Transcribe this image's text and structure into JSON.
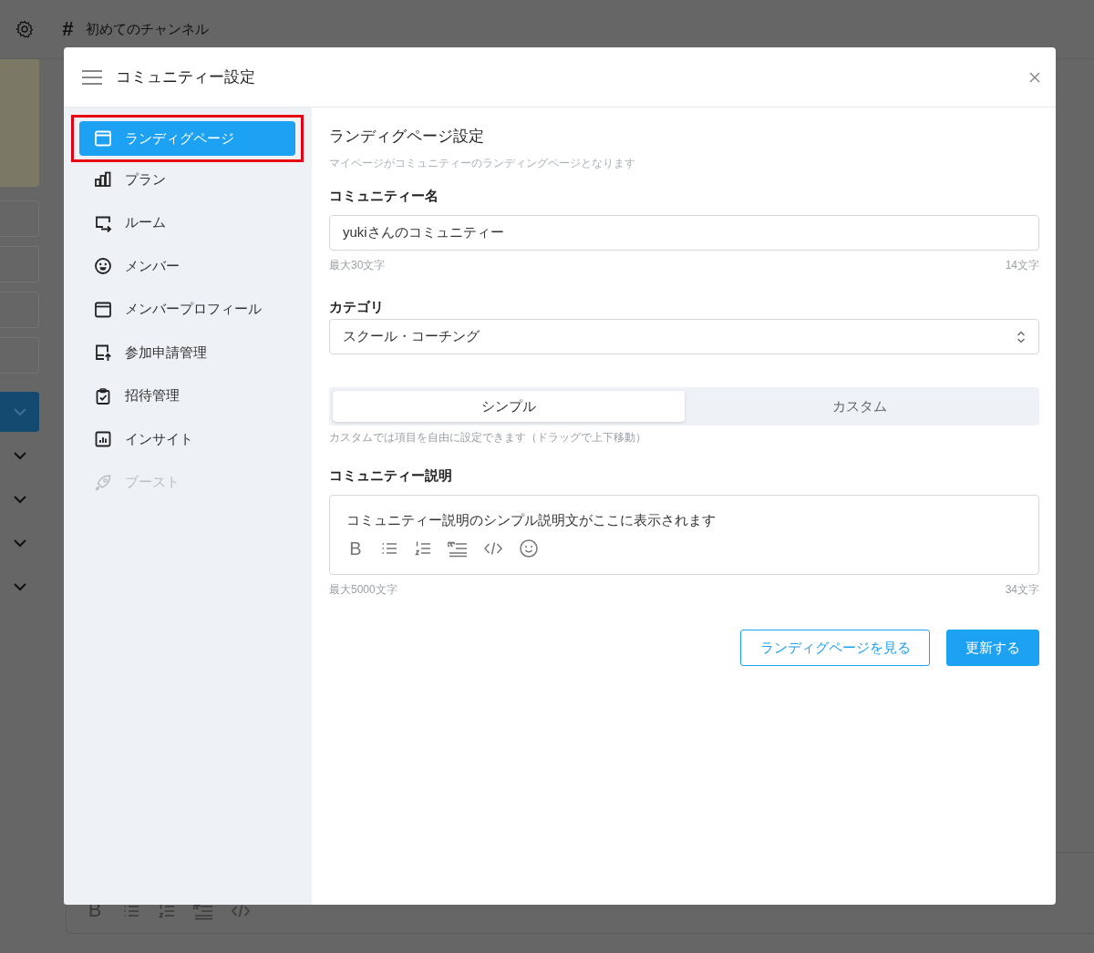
{
  "background": {
    "channel_mark": "#",
    "channel_title": "初めてのチャンネル",
    "editor_tools": [
      {
        "kind": "bold",
        "label": "B"
      },
      {
        "kind": "bullet_list"
      },
      {
        "kind": "numbered_list"
      },
      {
        "kind": "quote"
      },
      {
        "kind": "code"
      }
    ]
  },
  "modal": {
    "title": "コミュニティー設定",
    "sidebar": {
      "items": [
        {
          "kind": "landing",
          "label": "ランディグページ",
          "selected": true,
          "disabled": false,
          "highlighted": true
        },
        {
          "kind": "plan",
          "label": "プラン",
          "selected": false,
          "disabled": false,
          "highlighted": false
        },
        {
          "kind": "room",
          "label": "ルーム",
          "selected": false,
          "disabled": false,
          "highlighted": false
        },
        {
          "kind": "member",
          "label": "メンバー",
          "selected": false,
          "disabled": false,
          "highlighted": false
        },
        {
          "kind": "profile",
          "label": "メンバープロフィール",
          "selected": false,
          "disabled": false,
          "highlighted": false
        },
        {
          "kind": "request",
          "label": "参加申請管理",
          "selected": false,
          "disabled": false,
          "highlighted": false
        },
        {
          "kind": "invite",
          "label": "招待管理",
          "selected": false,
          "disabled": false,
          "highlighted": false
        },
        {
          "kind": "insight",
          "label": "インサイト",
          "selected": false,
          "disabled": false,
          "highlighted": false
        },
        {
          "kind": "boost",
          "label": "ブースト",
          "selected": false,
          "disabled": true,
          "highlighted": false
        }
      ]
    },
    "content": {
      "title": "ランディグページ設定",
      "subtitle": "マイページがコミュニティーのランディングページとなります",
      "name_field": {
        "label": "コミュニティー名",
        "value": "yukiさんのコミュニティー",
        "limit": "最大30文字",
        "count": "14文字"
      },
      "category_field": {
        "label": "カテゴリ",
        "value": "スクール・コーチング"
      },
      "mode_tabs": [
        {
          "label": "シンプル",
          "selected": true
        },
        {
          "label": "カスタム",
          "selected": false
        }
      ],
      "mode_hint": "カスタムでは項目を自由に設定できます（ドラッグで上下移動）",
      "description_field": {
        "label": "コミュニティー説明",
        "value": "コミュニティー説明のシンプル説明文がここに表示されます",
        "tools": [
          {
            "kind": "bold",
            "label": "B"
          },
          {
            "kind": "bullet_list"
          },
          {
            "kind": "numbered_list"
          },
          {
            "kind": "quote"
          },
          {
            "kind": "code"
          },
          {
            "kind": "emoji"
          }
        ],
        "limit": "最大5000文字",
        "count": "34文字"
      },
      "buttons": [
        {
          "kind": "secondary",
          "label": "ランディグページを見る"
        },
        {
          "kind": "primary",
          "label": "更新する"
        }
      ]
    }
  }
}
